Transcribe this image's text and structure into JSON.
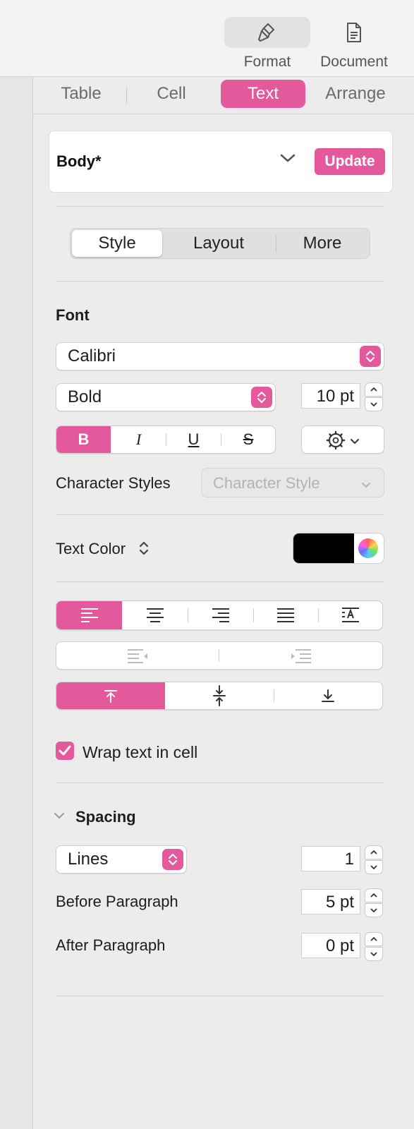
{
  "toolbar": {
    "format_label": "Format",
    "document_label": "Document"
  },
  "tabs": [
    "Table",
    "Cell",
    "Text",
    "Arrange"
  ],
  "style_card": {
    "name": "Body*",
    "update_label": "Update"
  },
  "segments": [
    "Style",
    "Layout",
    "More"
  ],
  "font": {
    "heading": "Font",
    "family": "Calibri",
    "typeface": "Bold",
    "size": "10 pt",
    "b_label": "B",
    "i_label": "I",
    "u_label": "U",
    "s_label": "S"
  },
  "character_styles": {
    "label": "Character Styles",
    "placeholder": "Character Style"
  },
  "text_color": {
    "label": "Text Color",
    "swatch": "#000000"
  },
  "wrap": {
    "label": "Wrap text in cell",
    "checked": true
  },
  "spacing": {
    "heading": "Spacing",
    "lines_mode": "Lines",
    "lines_value": "1",
    "before_label": "Before Paragraph",
    "before_value": "5 pt",
    "after_label": "After Paragraph",
    "after_value": "0 pt"
  },
  "colors": {
    "accent": "#e4589c"
  }
}
